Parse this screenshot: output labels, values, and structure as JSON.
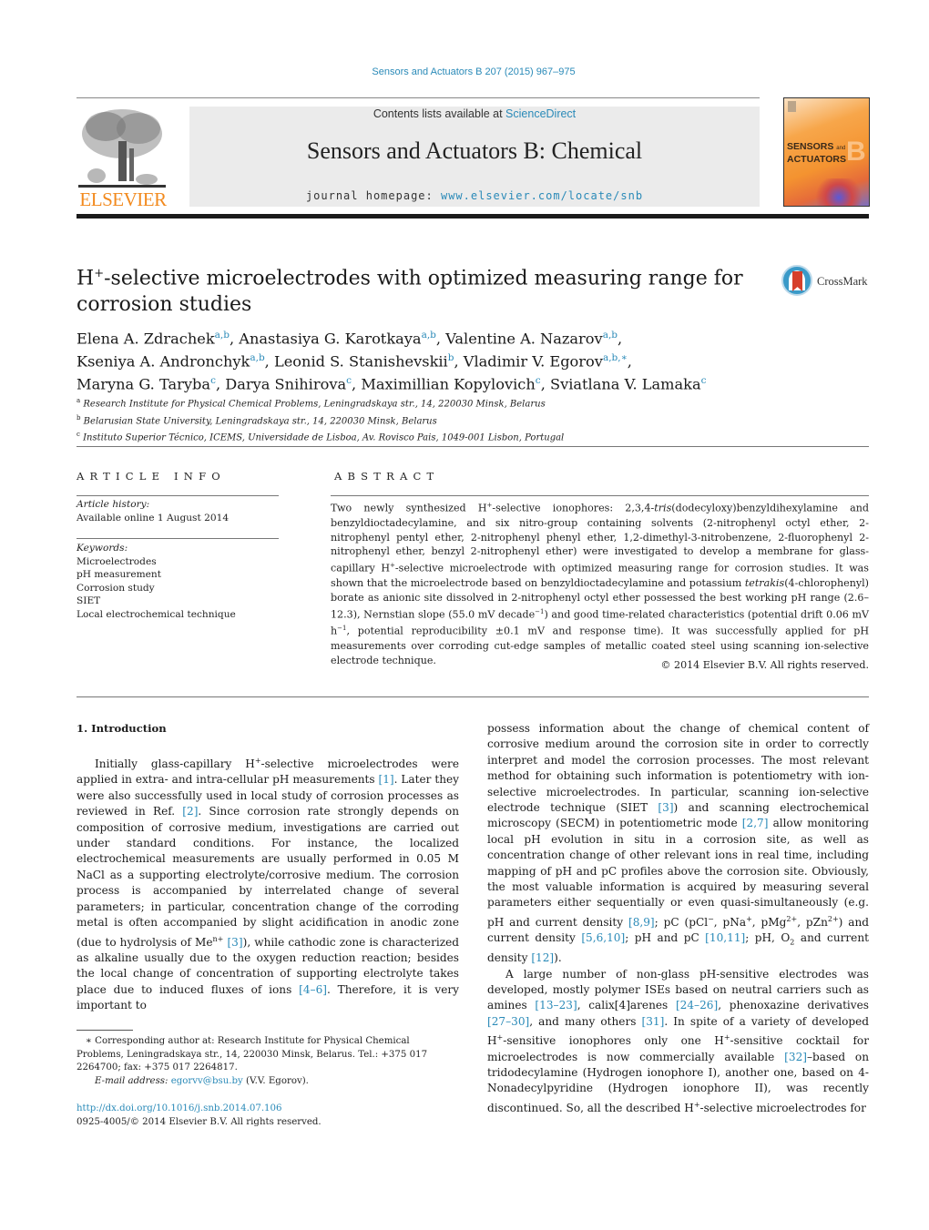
{
  "header": {
    "journal_citation": "Sensors and Actuators B 207 (2015) 967–975",
    "publisher_name": "ELSEVIER",
    "contents_prefix": "Contents lists available at ",
    "contents_link": "ScienceDirect",
    "journal_title": "Sensors and Actuators B: Chemical",
    "homepage_prefix": "journal homepage: ",
    "homepage_link": "www.elsevier.com/locate/snb",
    "cover": {
      "title_line1": "SENSORS",
      "title_and": "and",
      "title_line2": "ACTUATORS",
      "letter": "B"
    },
    "colors": {
      "link": "#2a8ab8",
      "elsevier_orange": "#f28a1e"
    }
  },
  "article": {
    "title_prefix": "H",
    "title_sup": "+",
    "title_rest": "-selective microelectrodes with optimized measuring range for corrosion studies",
    "crossmark_label": "CrossMark",
    "authors": [
      {
        "name": "Elena A. Zdrachek",
        "aff": "a,b",
        "sep": ", "
      },
      {
        "name": "Anastasiya G. Karotkaya",
        "aff": "a,b",
        "sep": ", "
      },
      {
        "name": "Valentine A. Nazarov",
        "aff": "a,b",
        "sep": ","
      },
      {
        "name": "Kseniya A. Andronchyk",
        "aff": "a,b",
        "sep": ", "
      },
      {
        "name": "Leonid S. Stanishevskii",
        "aff": "b",
        "sep": ", "
      },
      {
        "name": "Vladimir V. Egorov",
        "aff": "a,b,∗",
        "sep": ","
      },
      {
        "name": "Maryna G. Taryba",
        "aff": "c",
        "sep": ", "
      },
      {
        "name": "Darya Snihirova",
        "aff": "c",
        "sep": ", "
      },
      {
        "name": "Maximillian Kopylovich",
        "aff": "c",
        "sep": ", "
      },
      {
        "name": "Sviatlana V. Lamaka",
        "aff": "c",
        "sep": ""
      }
    ],
    "affiliations": [
      {
        "key": "a",
        "text": "Research Institute for Physical Chemical Problems, Leningradskaya str., 14, 220030 Minsk, Belarus"
      },
      {
        "key": "b",
        "text": "Belarusian State University, Leningradskaya str., 14, 220030 Minsk, Belarus"
      },
      {
        "key": "c",
        "text": "Instituto Superior Técnico, ICEMS, Universidade de Lisboa, Av. Rovisco Pais, 1049-001 Lisbon, Portugal"
      }
    ]
  },
  "article_info": {
    "heading": "ARTICLE INFO",
    "history_label": "Article history:",
    "history_value": "Available online 1 August 2014",
    "keywords_label": "Keywords:",
    "keywords": [
      "Microelectrodes",
      "pH measurement",
      "Corrosion study",
      "SIET",
      "Local electrochemical technique"
    ]
  },
  "abstract": {
    "heading": "ABSTRACT",
    "p1": "Two newly synthesized H",
    "p2": "-selective ionophores: 2,3,4-",
    "tris": "tris",
    "p3": "(dodecyloxy)benzyldihexylamine and benzyldioctadecylamine, and six nitro-group containing solvents (2-nitrophenyl octyl ether, 2-nitrophenyl pentyl ether, 2-nitrophenyl phenyl ether, 1,2-dimethyl-3-nitrobenzene, 2-fluorophenyl 2-nitrophenyl ether, benzyl 2-nitrophenyl ether) were investigated to develop a membrane for glass-capillary H",
    "p4": "-selective microelectrode with optimized measuring range for corrosion studies. It was shown that the microelectrode based on benzyldioctadecylamine and potassium ",
    "tetrakis": "tetrakis",
    "p5": "(4-chlorophenyl) borate as anionic site dissolved in 2-nitrophenyl octyl ether possessed the best working pH range (2.6–12.3), Nernstian slope (55.0 mV decade",
    "p6": ") and good time-related characteristics (potential drift 0.06 mV h",
    "p7": ", potential reproducibility ±0.1 mV and response time). It was successfully applied for pH measurements over corroding cut-edge samples of metallic coated steel using scanning ion-selective electrode technique.",
    "sup_plus": "+",
    "sup_minus1": "−1",
    "copyright": "© 2014 Elsevier B.V. All rights reserved."
  },
  "intro": {
    "heading": "1.  Introduction",
    "left": {
      "a": "Initially glass-capillary H",
      "b": "-selective microelectrodes were applied in extra- and intra-cellular pH measurements ",
      "r1": "[1]",
      "c": ". Later they were also successfully used in local study of corrosion processes as reviewed in Ref. ",
      "r2": "[2]",
      "d": ". Since corrosion rate strongly depends on composition of corrosive medium, investigations are carried out under standard conditions. For instance, the localized electrochemical measurements are usually performed in 0.05 M NaCl as a supporting electrolyte/corrosive medium. The corrosion process is accompanied by interrelated change of several parameters; in particular, concentration change of the corroding metal is often accompanied by slight acidification in anodic zone (due to hydrolysis of Me",
      "men": "n+",
      "r3": "[3]",
      "e": "), while cathodic zone is characterized as alkaline usually due to the oxygen reduction reaction; besides the local change of concentration of supporting electrolyte takes place due to induced fluxes of ions ",
      "r4": "[4–6]",
      "f": ". Therefore, it is very important to"
    },
    "right1": {
      "a": "possess information about the change of chemical content of corrosive medium around the corrosion site in order to correctly interpret and model the corrosion processes. The most relevant method for obtaining such information is potentiometry with ion-selective microelectrodes. In particular, scanning ion-selective electrode technique (SIET ",
      "r3": "[3]",
      "b": ") and scanning electrochemical microscopy (SECM) in potentiometric mode ",
      "r27": "[2,7]",
      "c": " allow monitoring local pH evolution in situ in a corrosion site, as well as concentration change of other relevant ions in real time, including mapping of pH and pC profiles above the corrosion site. Obviously, the most valuable information is acquired by measuring several parameters either sequentially or even quasi-simultaneously (e.g. pH and current density ",
      "r89": "[8,9]",
      "d": "; pC (pCl",
      "e": ", pNa",
      "f": ", pMg",
      "g": ", pZn",
      "h": ") and current density ",
      "r5610": "[5,6,10]",
      "i": "; pH and pC ",
      "r1011": "[10,11]",
      "j": "; pH, O",
      "k": " and current density ",
      "r12": "[12]",
      "l": ")."
    },
    "right2": {
      "a": "A large number of non-glass pH-sensitive electrodes was developed, mostly polymer ISEs based on neutral carriers such as amines ",
      "r1": "[13–23]",
      "b": ", calix[4]arenes ",
      "r2": "[24–26]",
      "c": ", phenoxazine derivatives ",
      "r3": "[27–30]",
      "d": ", and many others ",
      "r4": "[31]",
      "e": ". In spite of a variety of developed H",
      "f": "-sensitive ionophores only one H",
      "g": "-sensitive cocktail for microelectrodes is now commercially available ",
      "r5": "[32]",
      "h": "–based on tridodecylamine (Hydrogen ionophore I), another one, based on 4-Nonadecylpyridine (Hydrogen ionophore II), was recently discontinued. So, all the described H",
      "i": "-selective microelectrodes for"
    },
    "sup": {
      "plus": "+",
      "minus": "−",
      "two_plus": "2+",
      "two": "2"
    }
  },
  "footnote": {
    "star": "∗",
    "text": " Corresponding author at: Research Institute for Physical Chemical Problems, Leningradskaya str., 14, 220030 Minsk, Belarus. Tel.: +375 017 2264700; fax: +375 017 2264817.",
    "email_label": "E-mail address: ",
    "email": "egorvv@bsu.by",
    "email_suffix": " (V.V. Egorov).",
    "doi": "http://dx.doi.org/10.1016/j.snb.2014.07.106",
    "issn": "0925-4005/© 2014 Elsevier B.V. All rights reserved."
  }
}
